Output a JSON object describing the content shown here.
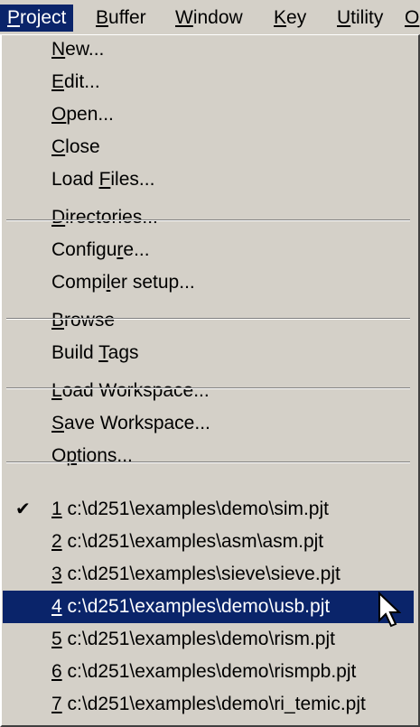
{
  "menubar": {
    "items": [
      {
        "label": "Project",
        "underline_index": 0,
        "active": true
      },
      {
        "label": "Buffer",
        "underline_index": 0
      },
      {
        "label": "Window",
        "underline_index": 0
      },
      {
        "label": "Key",
        "underline_index": 0
      },
      {
        "label": "Utility",
        "underline_index": 0
      },
      {
        "label": "Opti",
        "underline_index": 0
      }
    ]
  },
  "dropdown": {
    "groups": [
      [
        {
          "label": "New...",
          "underline_index": 0
        },
        {
          "label": "Edit...",
          "underline_index": 0
        },
        {
          "label": "Open...",
          "underline_index": 0
        },
        {
          "label": "Close",
          "underline_index": 0
        },
        {
          "label": "Load Files...",
          "underline_index": 5
        }
      ],
      [
        {
          "label": "Directories...",
          "underline_index": 0
        },
        {
          "label": "Configure...",
          "underline_index": 7
        },
        {
          "label": "Compiler setup...",
          "underline_index": 5
        }
      ],
      [
        {
          "label": "Browse",
          "underline_index": 0
        },
        {
          "label": "Build Tags",
          "underline_index": 6
        }
      ],
      [
        {
          "label": "Load Workspace...",
          "underline_index": 0
        },
        {
          "label": "Save Workspace...",
          "underline_index": 0
        },
        {
          "label": "Options...",
          "underline_index": 1
        }
      ],
      [
        {
          "label": "1 c:\\d251\\examples\\demo\\sim.pjt",
          "underline_index": 0,
          "checked": true
        },
        {
          "label": "2 c:\\d251\\examples\\asm\\asm.pjt",
          "underline_index": 0
        },
        {
          "label": "3 c:\\d251\\examples\\sieve\\sieve.pjt",
          "underline_index": 0
        },
        {
          "label": "4 c:\\d251\\examples\\demo\\usb.pjt",
          "underline_index": 0,
          "highlighted": true
        },
        {
          "label": "5 c:\\d251\\examples\\demo\\rism.pjt",
          "underline_index": 0
        },
        {
          "label": "6 c:\\d251\\examples\\demo\\rismpb.pjt",
          "underline_index": 0
        },
        {
          "label": "7 c:\\d251\\examples\\demo\\ri_temic.pjt",
          "underline_index": 0
        }
      ]
    ]
  },
  "icons": {
    "check": "check-mark-icon",
    "cursor": "arrow-cursor-icon"
  },
  "colors": {
    "menu_bg": "#d4d0c8",
    "highlight_bg": "#0a246a",
    "highlight_text": "#ffffff",
    "text": "#000000"
  }
}
